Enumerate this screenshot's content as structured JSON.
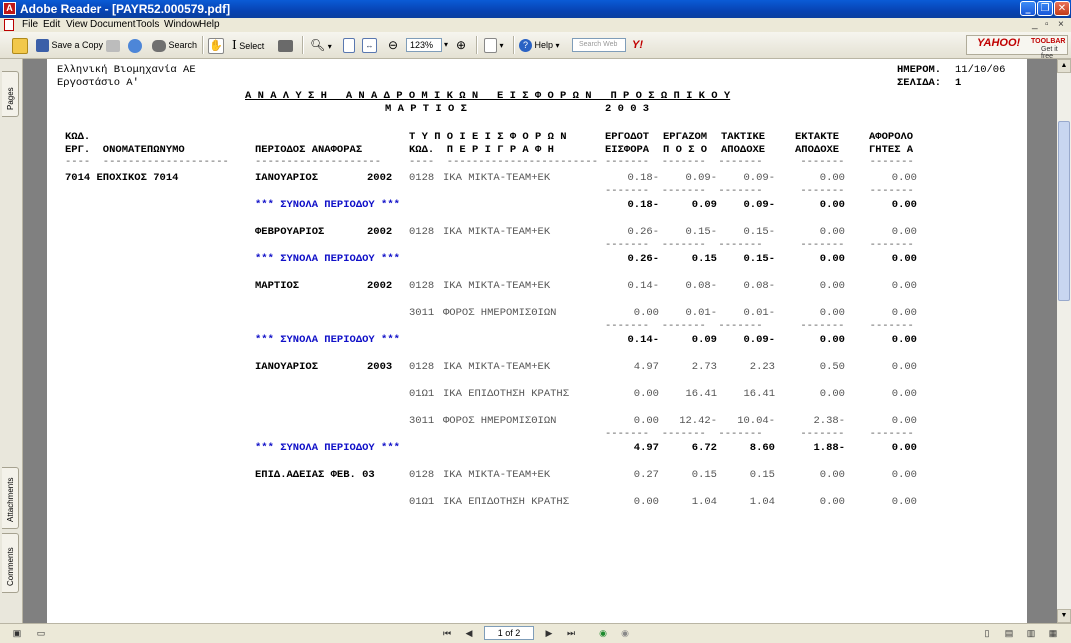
{
  "window": {
    "title": "Adobe Reader - [PAYR52.000579.pdf]"
  },
  "menu": [
    "File",
    "Edit",
    "View",
    "Document",
    "Tools",
    "Window",
    "Help"
  ],
  "toolbar": {
    "save_copy": "Save a Copy",
    "search": "Search",
    "select": "Select",
    "zoom": "123%",
    "help": "Help",
    "search_web_placeholder": "Search Web",
    "yahoo": "YAHOO!",
    "yahoo_toolbar": "TOOLBAR",
    "yahoo_get": "Get it free"
  },
  "sidebar_tabs": [
    "Pages",
    "Attachments",
    "Comments"
  ],
  "report": {
    "company": "Ελληνική Βιομηχανία ΑΕ",
    "plant": "Εργοστάσιο Α'",
    "title": "Α Ν Α Λ Υ Σ Η   Α Ν Α Δ Ρ Ο Μ Ι Κ Ω Ν   Ε Ι Σ Φ Ο Ρ Ω Ν   Π Ρ Ο Σ Ω Π Ι Κ Ο Υ",
    "month": "Μ Α Ρ Τ Ι Ο Σ",
    "year": "2 0 0 3",
    "date_label": "ΗΜΕΡΟΜ.",
    "date_value": "11/10/06",
    "page_label": "ΣΕΛΙΔΑ:",
    "page_value": "1",
    "headers": {
      "h1a": "ΚΩΔ.",
      "h1b": "ΕΡΓ.  ΟΝΟΜΑΤΕΠΩΝΥΜΟ",
      "h2": "ΠΕΡΙΟΔΟΣ ΑΝΑΦΟΡΑΣ",
      "h3a": "Τ Υ Π Ο Ι Ε Ι Σ Φ Ο Ρ Ω Ν",
      "h3b": "ΚΩΔ.  Π Ε Ρ Ι Γ Ρ Α Φ Η",
      "h4a": "ΕΡΓΟΔΟΤ",
      "h4b": "ΕΙΣΦΟΡΑ",
      "h5a": "ΕΡΓΑΖΟΜ",
      "h5b": "Π Ο Σ Ο",
      "h6a": "ΤΑΚΤΙΚΕ",
      "h6b": "ΑΠΟΔΟΧΕ",
      "h7a": "ΕΚΤΑΚΤΕ",
      "h7b": "ΑΠΟΔΟΧΕ",
      "h8a": "ΑΦΟΡΟΛΟ",
      "h8b": "ΓΗΤΕΣ Α"
    },
    "dashes": {
      "d1": "----  --------------------",
      "d2": "--------------------",
      "d3": "----  ------------------------",
      "d7": "-------  -------  -------      -------    -------"
    },
    "employee": "7014 ΕΠΟΧΙΚΟΣ 7014",
    "total_label": "*** ΣΥΝΟΛΑ ΠΕΡΙΟΔΟΥ ***",
    "rows": [
      {
        "period": "ΙΑΝΟΥΑΡΙΟΣ",
        "year": "2002",
        "code": "0128",
        "desc": "ΙΚΑ ΜΙΚΤΑ-TEAM+EK",
        "v": [
          "0.18-",
          "0.09-",
          "0.09-",
          "0.00",
          "0.00"
        ]
      },
      {
        "total": [
          "0.18-",
          "0.09",
          "0.09-",
          "0.00",
          "0.00"
        ]
      },
      {
        "period": "ΦΕΒΡΟΥΑΡΙΟΣ",
        "year": "2002",
        "code": "0128",
        "desc": "ΙΚΑ ΜΙΚΤΑ-TEAM+EK",
        "v": [
          "0.26-",
          "0.15-",
          "0.15-",
          "0.00",
          "0.00"
        ]
      },
      {
        "total": [
          "0.26-",
          "0.15",
          "0.15-",
          "0.00",
          "0.00"
        ]
      },
      {
        "period": "ΜΑΡΤΙΟΣ",
        "year": "2002",
        "code": "0128",
        "desc": "ΙΚΑ ΜΙΚΤΑ-TEAM+EK",
        "v": [
          "0.14-",
          "0.08-",
          "0.08-",
          "0.00",
          "0.00"
        ]
      },
      {
        "code": "3011",
        "desc": "ΦΟΡΟΣ ΗΜΕΡΟΜΙΣΘΙΩΝ",
        "v": [
          "0.00",
          "0.01-",
          "0.01-",
          "0.00",
          "0.00"
        ]
      },
      {
        "total": [
          "0.14-",
          "0.09",
          "0.09-",
          "0.00",
          "0.00"
        ]
      },
      {
        "period": "ΙΑΝΟΥΑΡΙΟΣ",
        "year": "2003",
        "code": "0128",
        "desc": "ΙΚΑ ΜΙΚΤΑ-TEAM+EK",
        "v": [
          "4.97",
          "2.73",
          "2.23",
          "0.50",
          "0.00"
        ]
      },
      {
        "code": "01Ω1",
        "desc": "ΙΚΑ ΕΠΙΔΟΤΗΣΗ ΚΡΑΤΗΣ",
        "v": [
          "0.00",
          "16.41",
          "16.41",
          "0.00",
          "0.00"
        ]
      },
      {
        "code": "3011",
        "desc": "ΦΟΡΟΣ ΗΜΕΡΟΜΙΣΘΙΩΝ",
        "v": [
          "0.00",
          "12.42-",
          "10.04-",
          "2.38-",
          "0.00"
        ]
      },
      {
        "total": [
          "4.97",
          "6.72",
          "8.60",
          "1.88-",
          "0.00"
        ]
      },
      {
        "period": "ΕΠΙΔ.ΑΔΕΙΑΣ ΦΕΒ. 03",
        "year": "",
        "code": "0128",
        "desc": "ΙΚΑ ΜΙΚΤΑ-TEAM+EK",
        "v": [
          "0.27",
          "0.15",
          "0.15",
          "0.00",
          "0.00"
        ]
      },
      {
        "code": "01Ω1",
        "desc": "ΙΚΑ ΕΠΙΔΟΤΗΣΗ ΚΡΑΤΗΣ",
        "v": [
          "0.00",
          "1.04",
          "1.04",
          "0.00",
          "0.00"
        ]
      }
    ]
  },
  "status": {
    "page": "1 of 2"
  }
}
